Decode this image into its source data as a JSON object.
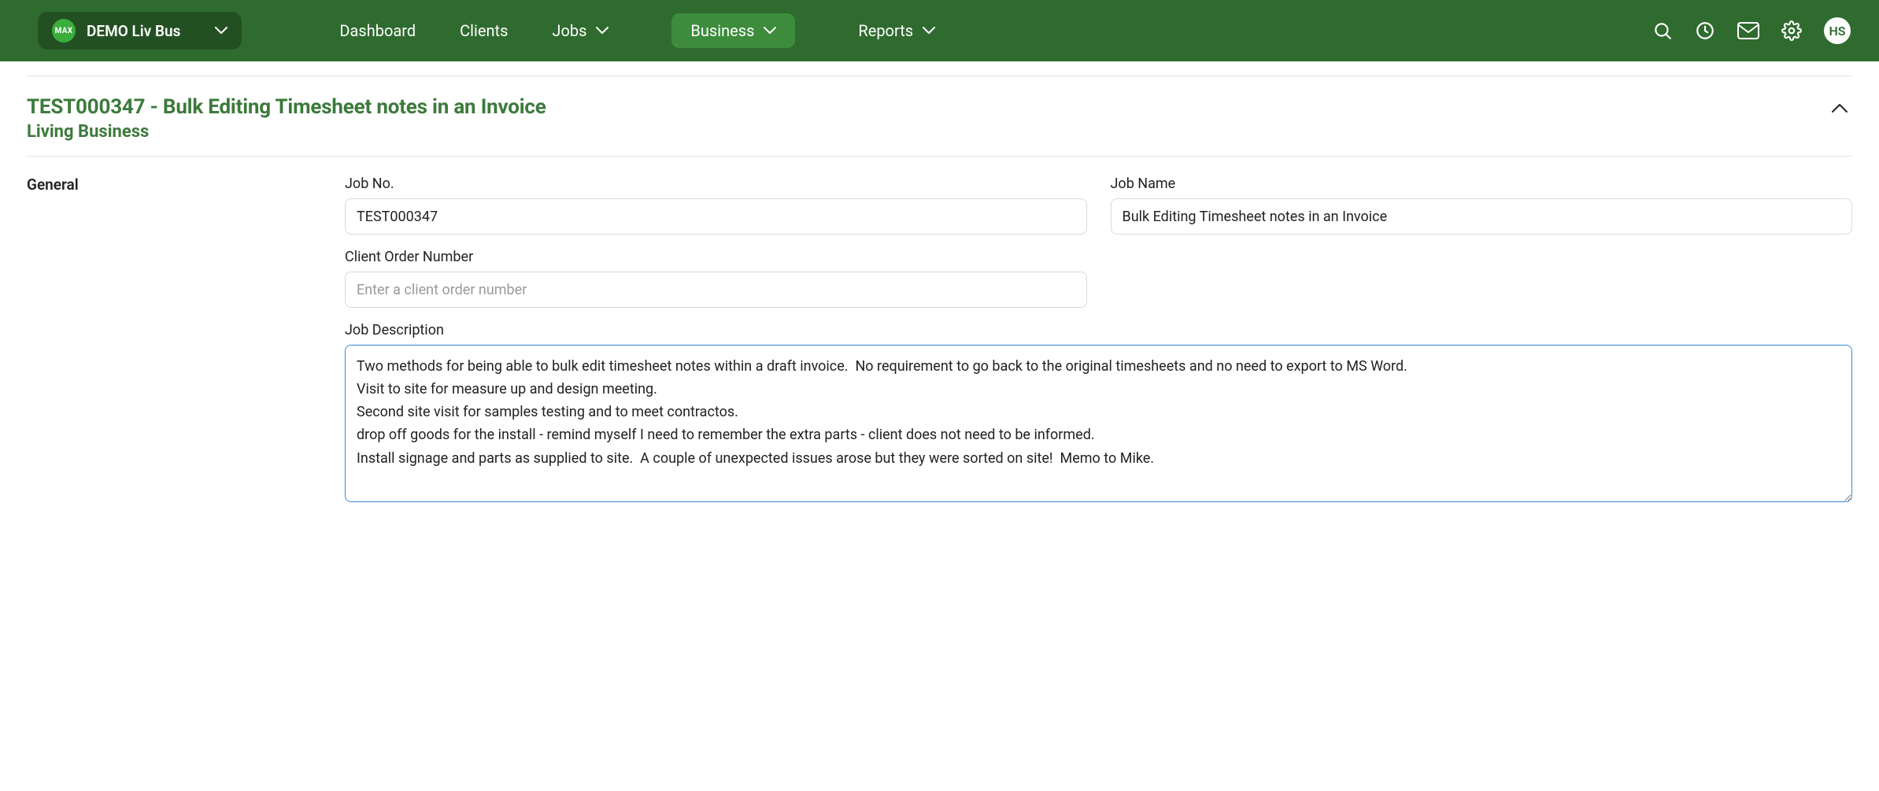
{
  "nav": {
    "org_badge": "MAX",
    "org_name": "DEMO Liv Bus",
    "items": [
      {
        "label": "Dashboard",
        "has_chev": false,
        "active": false
      },
      {
        "label": "Clients",
        "has_chev": false,
        "active": false
      },
      {
        "label": "Jobs",
        "has_chev": true,
        "active": false
      },
      {
        "label": "Business",
        "has_chev": true,
        "active": true
      },
      {
        "label": "Reports",
        "has_chev": true,
        "active": false
      }
    ],
    "avatar_initials": "HS"
  },
  "header": {
    "job_title": "TEST000347 - Bulk Editing Timesheet notes in an Invoice",
    "client_name": "Living Business"
  },
  "section": {
    "label": "General"
  },
  "fields": {
    "job_no_label": "Job No.",
    "job_no_value": "TEST000347",
    "job_name_label": "Job Name",
    "job_name_value": "Bulk Editing Timesheet notes in an Invoice",
    "client_order_label": "Client Order Number",
    "client_order_placeholder": "Enter a client order number",
    "client_order_value": "",
    "job_description_label": "Job Description",
    "job_description_value": "Two methods for being able to bulk edit timesheet notes within a draft invoice.  No requirement to go back to the original timesheets and no need to export to MS Word.\nVisit to site for measure up and design meeting.\nSecond site visit for samples testing and to meet contractos.\ndrop off goods for the install - remind myself I need to remember the extra parts - client does not need to be informed.\nInstall signage and parts as supplied to site.  A couple of unexpected issues arose but they were sorted on site!  Memo to Mike."
  }
}
